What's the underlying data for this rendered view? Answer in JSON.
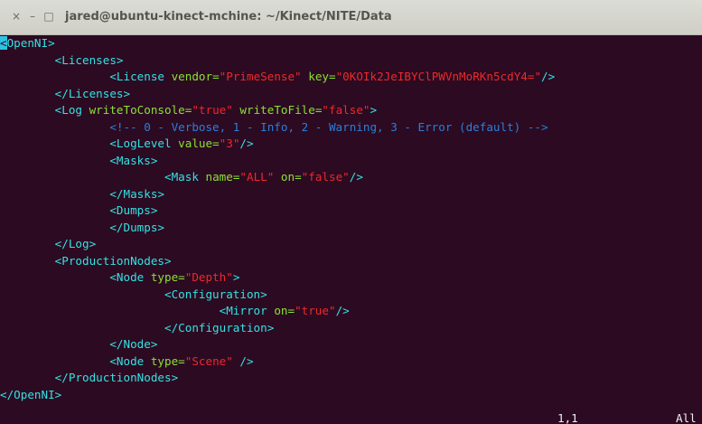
{
  "window": {
    "title": "jared@ubuntu-kinect-mchine: ~/Kinect/NITE/Data",
    "close_glyph": "×",
    "minimize_glyph": "–",
    "maximize_glyph": "□"
  },
  "editor": {
    "lines": [
      [
        {
          "t": "tag",
          "v": "<"
        },
        {
          "t": "tag",
          "v": "OpenNI>"
        }
      ],
      [
        {
          "t": "text",
          "v": "        "
        },
        {
          "t": "tag",
          "v": "<Licenses>"
        }
      ],
      [
        {
          "t": "text",
          "v": "                "
        },
        {
          "t": "tag",
          "v": "<License "
        },
        {
          "t": "attr",
          "v": "vendor="
        },
        {
          "t": "str",
          "v": "\"PrimeSense\""
        },
        {
          "t": "attr",
          "v": " key="
        },
        {
          "t": "str",
          "v": "\"0KOIk2JeIBYClPWVnMoRKn5cdY4=\""
        },
        {
          "t": "tag",
          "v": "/>"
        }
      ],
      [
        {
          "t": "text",
          "v": "        "
        },
        {
          "t": "tag",
          "v": "</Licenses>"
        }
      ],
      [
        {
          "t": "text",
          "v": "        "
        },
        {
          "t": "tag",
          "v": "<Log "
        },
        {
          "t": "attr",
          "v": "writeToConsole="
        },
        {
          "t": "str",
          "v": "\"true\""
        },
        {
          "t": "attr",
          "v": " writeToFile="
        },
        {
          "t": "str",
          "v": "\"false\""
        },
        {
          "t": "tag",
          "v": ">"
        }
      ],
      [
        {
          "t": "text",
          "v": "                "
        },
        {
          "t": "comment",
          "v": "<!-- 0 - Verbose, 1 - Info, 2 - Warning, 3 - Error (default) -->"
        }
      ],
      [
        {
          "t": "text",
          "v": "                "
        },
        {
          "t": "tag",
          "v": "<LogLevel "
        },
        {
          "t": "attr",
          "v": "value="
        },
        {
          "t": "str",
          "v": "\"3\""
        },
        {
          "t": "tag",
          "v": "/>"
        }
      ],
      [
        {
          "t": "text",
          "v": "                "
        },
        {
          "t": "tag",
          "v": "<Masks>"
        }
      ],
      [
        {
          "t": "text",
          "v": "                        "
        },
        {
          "t": "tag",
          "v": "<Mask "
        },
        {
          "t": "attr",
          "v": "name="
        },
        {
          "t": "str",
          "v": "\"ALL\""
        },
        {
          "t": "attr",
          "v": " on="
        },
        {
          "t": "str",
          "v": "\"false\""
        },
        {
          "t": "tag",
          "v": "/>"
        }
      ],
      [
        {
          "t": "text",
          "v": "                "
        },
        {
          "t": "tag",
          "v": "</Masks>"
        }
      ],
      [
        {
          "t": "text",
          "v": "                "
        },
        {
          "t": "tag",
          "v": "<Dumps>"
        }
      ],
      [
        {
          "t": "text",
          "v": "                "
        },
        {
          "t": "tag",
          "v": "</Dumps>"
        }
      ],
      [
        {
          "t": "text",
          "v": "        "
        },
        {
          "t": "tag",
          "v": "</Log>"
        }
      ],
      [
        {
          "t": "text",
          "v": "        "
        },
        {
          "t": "tag",
          "v": "<ProductionNodes>"
        }
      ],
      [
        {
          "t": "text",
          "v": "                "
        },
        {
          "t": "tag",
          "v": "<Node "
        },
        {
          "t": "attr",
          "v": "type="
        },
        {
          "t": "str",
          "v": "\"Depth\""
        },
        {
          "t": "tag",
          "v": ">"
        }
      ],
      [
        {
          "t": "text",
          "v": "                        "
        },
        {
          "t": "tag",
          "v": "<Configuration>"
        }
      ],
      [
        {
          "t": "text",
          "v": "                                "
        },
        {
          "t": "tag",
          "v": "<Mirror "
        },
        {
          "t": "attr",
          "v": "on="
        },
        {
          "t": "str",
          "v": "\"true\""
        },
        {
          "t": "tag",
          "v": "/>"
        }
      ],
      [
        {
          "t": "text",
          "v": "                        "
        },
        {
          "t": "tag",
          "v": "</Configuration>"
        }
      ],
      [
        {
          "t": "text",
          "v": "                "
        },
        {
          "t": "tag",
          "v": "</Node>"
        }
      ],
      [
        {
          "t": "text",
          "v": "                "
        },
        {
          "t": "tag",
          "v": "<Node "
        },
        {
          "t": "attr",
          "v": "type="
        },
        {
          "t": "str",
          "v": "\"Scene\""
        },
        {
          "t": "tag",
          "v": " />"
        }
      ],
      [
        {
          "t": "text",
          "v": "        "
        },
        {
          "t": "tag",
          "v": "</ProductionNodes>"
        }
      ],
      [
        {
          "t": "tag",
          "v": "</OpenNI>"
        }
      ]
    ],
    "status": {
      "position": "1,1",
      "scroll": "All"
    }
  },
  "colors": {
    "background": "#2c0a22",
    "tag": "#34e2e2",
    "attribute": "#8ae234",
    "string": "#ef2929",
    "comment": "#2b7fd8",
    "cursor": "#2dc3e6"
  }
}
